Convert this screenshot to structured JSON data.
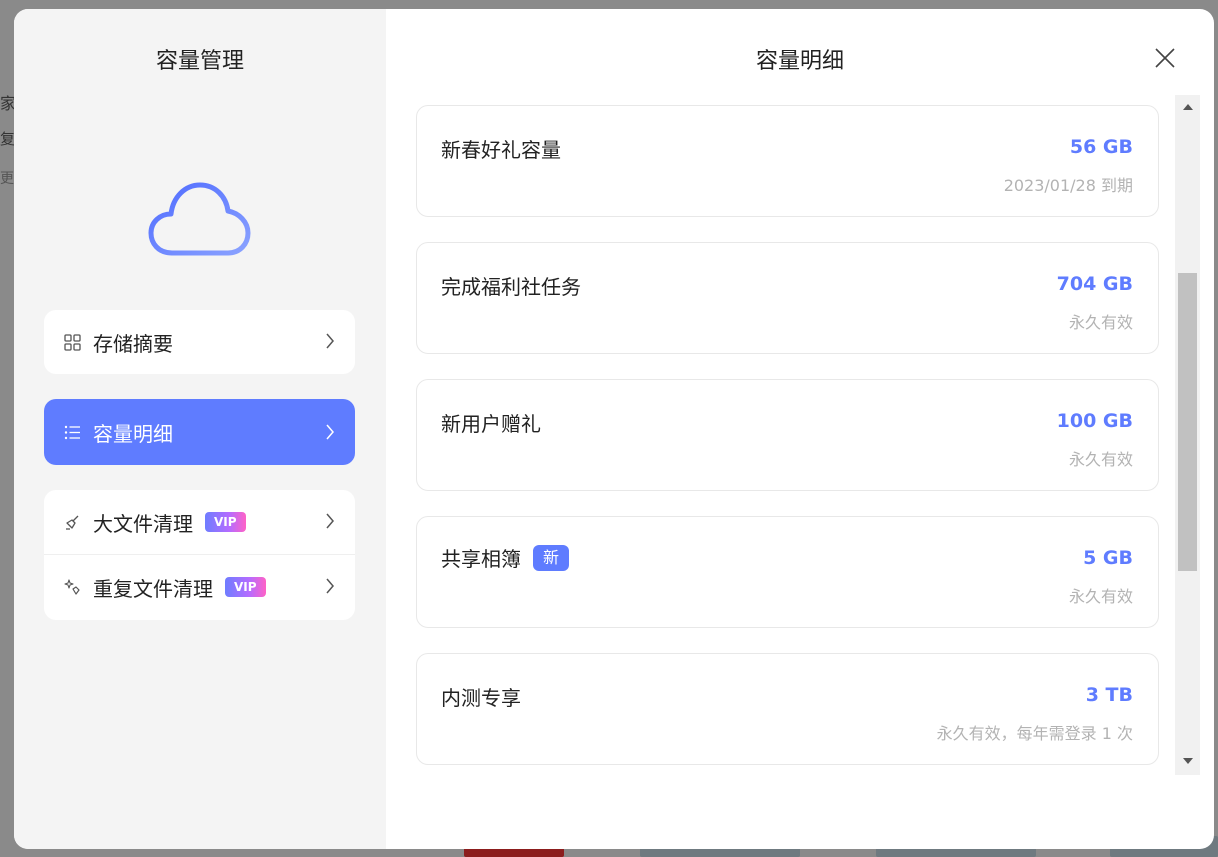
{
  "background": {
    "texts": [
      "家",
      "复",
      "更"
    ]
  },
  "sidebar": {
    "title": "容量管理",
    "items": [
      {
        "label": "存储摘要",
        "icon": "grid-icon",
        "active": false
      },
      {
        "label": "容量明细",
        "icon": "list-icon",
        "active": true
      },
      {
        "label": "大文件清理",
        "icon": "broom-icon",
        "badge": "VIP"
      },
      {
        "label": "重复文件清理",
        "icon": "sparkle-broom-icon",
        "badge": "VIP"
      }
    ]
  },
  "main": {
    "title": "容量明细",
    "items": [
      {
        "name": "新春好礼容量",
        "amount": "56 GB",
        "expiry": "2023/01/28 到期"
      },
      {
        "name": "完成福利社任务",
        "amount": "704 GB",
        "expiry": "永久有效"
      },
      {
        "name": "新用户赠礼",
        "amount": "100 GB",
        "expiry": "永久有效"
      },
      {
        "name": "共享相簿",
        "badge": "新",
        "amount": "5 GB",
        "expiry": "永久有效"
      },
      {
        "name": "内测专享",
        "amount": "3 TB",
        "expiry": "永久有效，每年需登录 1 次"
      }
    ]
  },
  "colors": {
    "accent": "#5f7cff",
    "sidebar_bg": "#f4f4f4",
    "muted_text": "#b3b3b3"
  }
}
